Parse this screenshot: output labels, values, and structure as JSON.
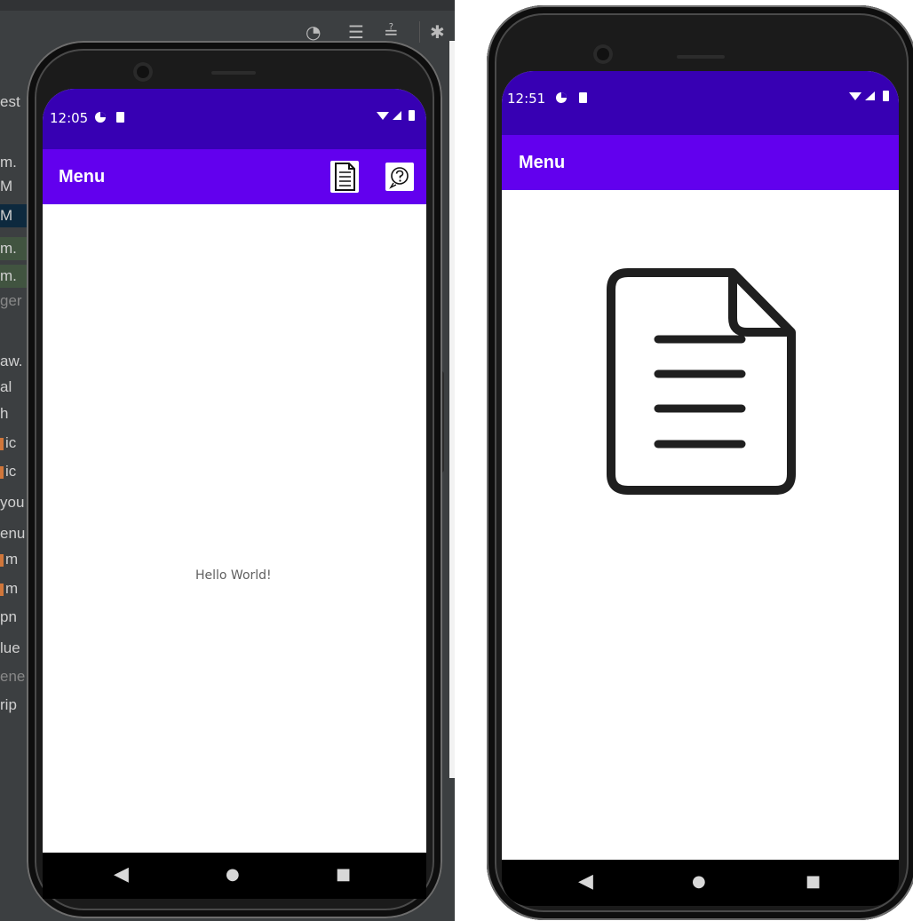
{
  "ide": {
    "left_rows": [
      {
        "text": "est",
        "style": "normal"
      },
      {
        "text": "m.",
        "style": "normal"
      },
      {
        "text": "M",
        "style": "normal"
      },
      {
        "text": "M",
        "style": "sel"
      },
      {
        "text": "m.",
        "style": "green"
      },
      {
        "text": "m.",
        "style": "green"
      },
      {
        "text": "ger",
        "style": "dim"
      },
      {
        "text": "aw.",
        "style": "normal"
      },
      {
        "text": "al",
        "style": "normal"
      },
      {
        "text": "h",
        "style": "normal"
      },
      {
        "text": "ic",
        "style": "marked"
      },
      {
        "text": "ic",
        "style": "marked"
      },
      {
        "text": "you",
        "style": "normal"
      },
      {
        "text": "enu",
        "style": "normal"
      },
      {
        "text": "m",
        "style": "marked"
      },
      {
        "text": "m",
        "style": "marked"
      },
      {
        "text": "pn",
        "style": "normal"
      },
      {
        "text": "lue",
        "style": "normal"
      },
      {
        "text": "ene",
        "style": "dim"
      },
      {
        "text": "rip",
        "style": "normal"
      }
    ]
  },
  "phone_left": {
    "status": {
      "time": "12:05"
    },
    "app_bar": {
      "title": "Menu"
    },
    "content": {
      "text": "Hello World!"
    }
  },
  "phone_right": {
    "status": {
      "time": "12:51"
    },
    "app_bar": {
      "title": "Menu"
    }
  },
  "nav": {
    "back": "◀",
    "home": "●",
    "recents": "■"
  }
}
